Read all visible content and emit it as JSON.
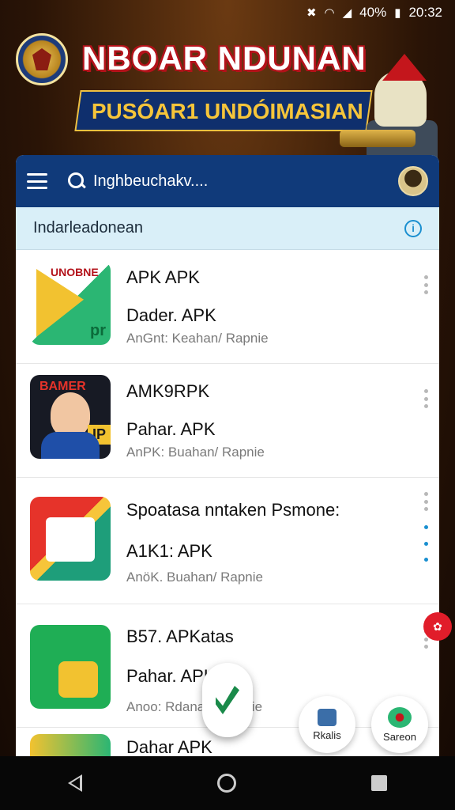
{
  "statusbar": {
    "battery": "40%",
    "time": "20:32"
  },
  "banner": {
    "title": "NBOAR NDUNAN",
    "subtitle": "PUSÓAR1 UNDÓIMASIAN"
  },
  "appbar": {
    "search_text": "Inghbeuchakv...."
  },
  "subbar": {
    "label": "Indarleadonean"
  },
  "list": [
    {
      "thumb_tag": "UNOBNE",
      "badge": "pr",
      "title": "APK APK",
      "subtitle": "Dader. APK",
      "meta": "AnGnt: Keahan/ Rapnie"
    },
    {
      "thumb_tag": "BAMER",
      "badge": "IP",
      "title": "AMK9RPK",
      "subtitle": "Pahar. APK",
      "meta": "AnPK: Buahan/ Rapnie"
    },
    {
      "title": "Spoatasa nntaken Psmone:",
      "subtitle": "A1K1: APK",
      "meta": "AnöK. Buahan/ Rapnie"
    },
    {
      "title": "B57. APKatas",
      "subtitle": "Pahar. APK",
      "meta": "Anoo: Rdanan/ Rapnie"
    },
    {
      "title": "Dahar APK"
    }
  ],
  "bottom_actions": {
    "left_label": "Rkalis",
    "right_label": "Sareon"
  }
}
